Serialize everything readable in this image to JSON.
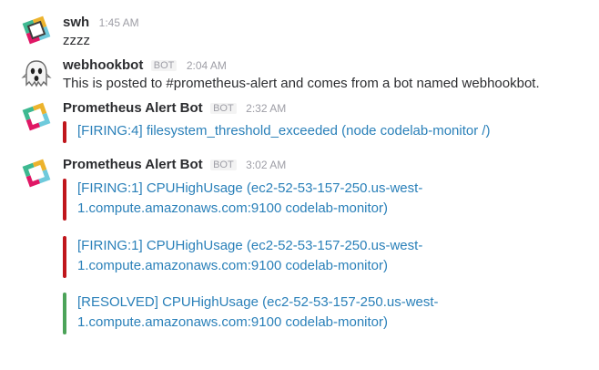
{
  "colors": {
    "firing": "#c0161c",
    "resolved": "#4ca359",
    "link": "#2a80b9"
  },
  "messages": [
    {
      "sender": "swh",
      "time": "1:45 AM",
      "text": "zzzz",
      "avatar": "slack-logo-icon"
    },
    {
      "sender": "webhookbot",
      "bot_badge": "BOT",
      "time": "2:04 AM",
      "text": "This is posted to #prometheus-alert and comes from a bot named webhookbot.",
      "avatar": "ghost-icon"
    },
    {
      "sender": "Prometheus Alert Bot",
      "bot_badge": "BOT",
      "time": "2:32 AM",
      "avatar": "slack-logo-icon",
      "attachments": [
        {
          "status": "firing",
          "link": "[FIRING:4] filesystem_threshold_exceeded (node codelab-monitor /)"
        }
      ]
    },
    {
      "sender": "Prometheus Alert Bot",
      "bot_badge": "BOT",
      "time": "3:02 AM",
      "avatar": "slack-logo-icon",
      "attachments": [
        {
          "status": "firing",
          "link": "[FIRING:1] CPUHighUsage (ec2-52-53-157-250.us-west-1.compute.amazonaws.com:9100 codelab-monitor)"
        },
        {
          "status": "firing",
          "link": "[FIRING:1] CPUHighUsage (ec2-52-53-157-250.us-west-1.compute.amazonaws.com:9100 codelab-monitor)"
        },
        {
          "status": "resolved",
          "link": "[RESOLVED] CPUHighUsage (ec2-52-53-157-250.us-west-1.compute.amazonaws.com:9100 codelab-monitor)"
        }
      ]
    }
  ]
}
